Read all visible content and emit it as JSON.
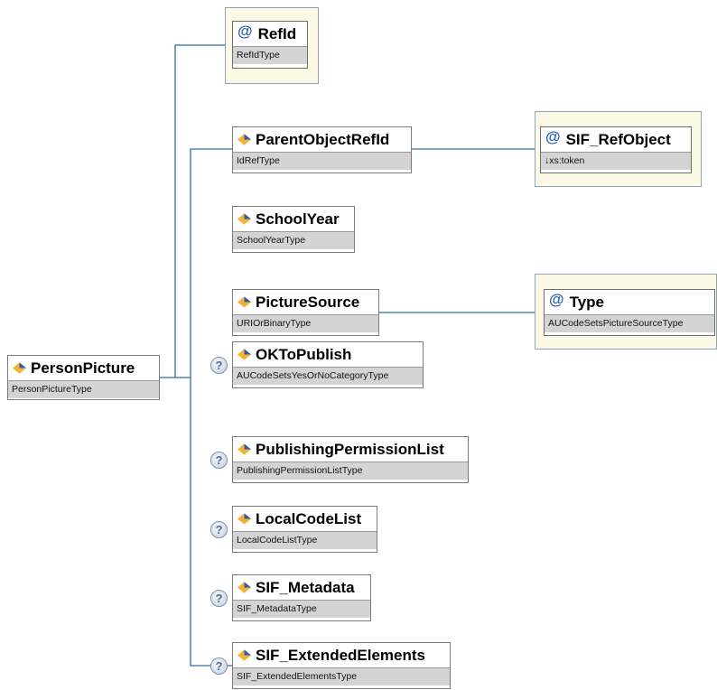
{
  "root": {
    "name": "PersonPicture",
    "type": "PersonPictureType"
  },
  "children": {
    "refid": {
      "name": "RefId",
      "type": "RefIdType"
    },
    "parentobjectrefid": {
      "name": "ParentObjectRefId",
      "type": "IdRefType"
    },
    "schoolyear": {
      "name": "SchoolYear",
      "type": "SchoolYearType"
    },
    "picturesource": {
      "name": "PictureSource",
      "type": "URIOrBinaryType"
    },
    "oktopublish": {
      "name": "OKToPublish",
      "type": "AUCodeSetsYesOrNoCategoryType"
    },
    "publishingpermissionlist": {
      "name": "PublishingPermissionList",
      "type": "PublishingPermissionListType"
    },
    "localcodelist": {
      "name": "LocalCodeList",
      "type": "LocalCodeListType"
    },
    "sif_metadata": {
      "name": "SIF_Metadata",
      "type": "SIF_MetadataType"
    },
    "sif_extendedelements": {
      "name": "SIF_ExtendedElements",
      "type": "SIF_ExtendedElementsType"
    }
  },
  "attributes": {
    "sif_refobject": {
      "name": "SIF_RefObject",
      "type": "↓xs:token"
    },
    "type": {
      "name": "Type",
      "type": "AUCodeSetsPictureSourceType"
    }
  },
  "symbols": {
    "attribute_marker": "@",
    "optional_marker": "?"
  },
  "icons": {
    "element": "element-diamond-icon",
    "attribute": "at-sign-icon",
    "optional": "question-mark-icon"
  },
  "colors": {
    "connector": "#2f6d9d",
    "attribute_frame": "#fbf8e6",
    "type_bar": "#d4d4d4",
    "icon_blue": "#2a5db0"
  }
}
